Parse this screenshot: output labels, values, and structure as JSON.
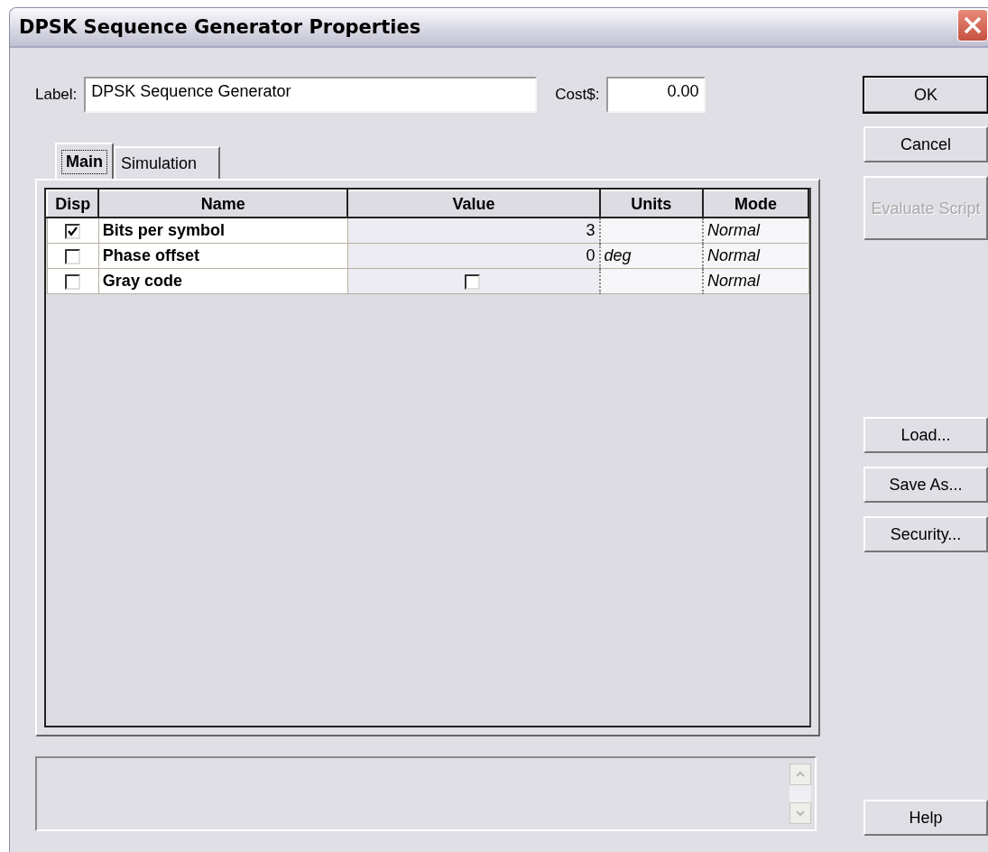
{
  "window": {
    "title": "DPSK Sequence Generator Properties"
  },
  "label_field": {
    "label": "Label:",
    "value": "DPSK Sequence Generator"
  },
  "cost_field": {
    "label": "Cost$:",
    "value": "0.00"
  },
  "tabs": [
    {
      "label": "Main",
      "selected": true
    },
    {
      "label": "Simulation",
      "selected": false
    }
  ],
  "table": {
    "columns": [
      "Disp",
      "Name",
      "Value",
      "Units",
      "Mode"
    ],
    "rows": [
      {
        "disp": true,
        "name": "Bits per symbol",
        "value": {
          "kind": "text",
          "text": "3"
        },
        "units": "",
        "mode": "Normal"
      },
      {
        "disp": false,
        "name": "Phase offset",
        "value": {
          "kind": "text",
          "text": "0"
        },
        "units": "deg",
        "mode": "Normal"
      },
      {
        "disp": false,
        "name": "Gray code",
        "value": {
          "kind": "checkbox",
          "checked": false
        },
        "units": "",
        "mode": "Normal"
      }
    ]
  },
  "buttons": [
    {
      "label": "OK",
      "default": true,
      "disabled": false
    },
    {
      "label": "Cancel",
      "default": false,
      "disabled": false
    },
    {
      "label": "Evaluate Script",
      "default": false,
      "disabled": true
    },
    {
      "label": "Load...",
      "default": false,
      "disabled": false
    },
    {
      "label": "Save As...",
      "default": false,
      "disabled": false
    },
    {
      "label": "Security...",
      "default": false,
      "disabled": false
    },
    {
      "label": "Help",
      "default": false,
      "disabled": false
    }
  ]
}
